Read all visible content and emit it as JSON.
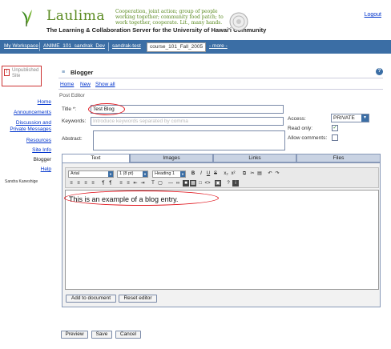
{
  "header": {
    "logo_text": "Laulima",
    "tagline": "Cooperation, joint action; group of people working together; community food patch; to work together, cooperate. Lit., many hands.",
    "subtitle": "The Learning & Collaboration Server for the University of Hawai'i Community",
    "logout": "Logout"
  },
  "tabs": [
    {
      "label": "My Workspace",
      "active": false
    },
    {
      "label": "ANIME_101_sandrak_Dev",
      "active": false
    },
    {
      "label": "sandrak-test",
      "active": false
    },
    {
      "label": "course_101_Fall_2005",
      "active": true
    },
    {
      "label": "- more -",
      "active": false
    }
  ],
  "sidebar": {
    "unpublished": "Unpublished Site",
    "unpublished_icon": "!",
    "items": [
      {
        "label": "Home"
      },
      {
        "label": "Announcements"
      },
      {
        "label": "Discussion and Private Messages"
      },
      {
        "label": "Resources"
      },
      {
        "label": "Site Info"
      },
      {
        "label": "Blogger"
      },
      {
        "label": "Help"
      }
    ],
    "user": "Sandra Kaneshige"
  },
  "portlet": {
    "title": "Blogger",
    "help": "?",
    "actions": [
      "Home",
      "New",
      "Show all"
    ],
    "section": "Post Editor"
  },
  "form": {
    "title_label": "Title *:",
    "title_value": "Test Blog",
    "keywords_label": "Keywords:",
    "keywords_placeholder": "Introduce keywords separated by comma",
    "abstract_label": "Abstract:",
    "access_label": "Access:",
    "access_value": "PRIVATE",
    "readonly_label": "Read only:",
    "readonly_checked": true,
    "comments_label": "Allow comments:",
    "comments_checked": false
  },
  "editor_tabs": [
    "Text",
    "Images",
    "Links",
    "Files"
  ],
  "editor": {
    "font": "Arial",
    "size": "1 (8 pt)",
    "format": "Heading 1",
    "content": "This is an example of a blog entry.",
    "add_button": "Add to document",
    "reset_button": "Reset editor"
  },
  "buttons": {
    "preview": "Preview",
    "save": "Save",
    "cancel": "Cancel"
  },
  "colors": {
    "brand_green": "#5a8a20",
    "tab_bar": "#3b6ea5",
    "annotation_red": "#e0141c",
    "link": "#0033cc"
  }
}
